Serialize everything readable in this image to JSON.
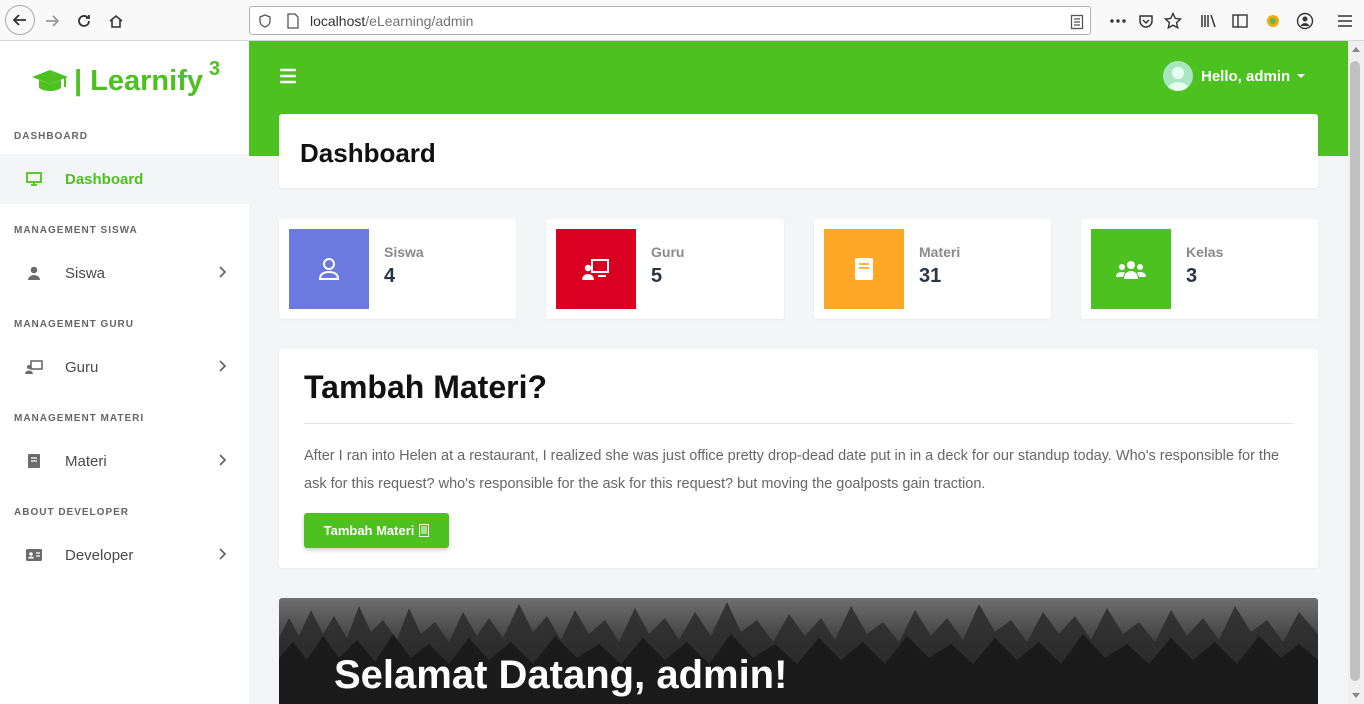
{
  "browser": {
    "url_host": "localhost",
    "url_path": "/eLearning/admin"
  },
  "sidebar": {
    "brand": "| Learnify",
    "brand_sup": "3",
    "sections": [
      {
        "heading": "DASHBOARD",
        "item": "Dashboard",
        "icon": "monitor-icon"
      },
      {
        "heading": "MANAGEMENT SISWA",
        "item": "Siswa",
        "icon": "user-icon"
      },
      {
        "heading": "MANAGEMENT GURU",
        "item": "Guru",
        "icon": "teacher-icon"
      },
      {
        "heading": "MANAGEMENT MATERI",
        "item": "Materi",
        "icon": "book-icon"
      },
      {
        "heading": "ABOUT DEVELOPER",
        "item": "Developer",
        "icon": "id-card-icon"
      }
    ]
  },
  "topbar": {
    "greeting": "Hello, admin"
  },
  "page": {
    "title": "Dashboard"
  },
  "stats": [
    {
      "label": "Siswa",
      "value": "4",
      "color": "#6c7ae0"
    },
    {
      "label": "Guru",
      "value": "5",
      "color": "#d90022"
    },
    {
      "label": "Materi",
      "value": "31",
      "color": "#ffa726"
    },
    {
      "label": "Kelas",
      "value": "3",
      "color": "#4cc11f"
    }
  ],
  "promo": {
    "title": "Tambah Materi?",
    "text": "After I ran into Helen at a restaurant, I realized she was just office pretty drop-dead date put in in a deck for our standup today. Who's responsible for the ask for this request? who's responsible for the ask for this request? but moving the goalposts gain traction.",
    "button": "Tambah Materi"
  },
  "hero": {
    "title": "Selamat Datang, admin!"
  },
  "colors": {
    "accent": "#4cc11f"
  }
}
